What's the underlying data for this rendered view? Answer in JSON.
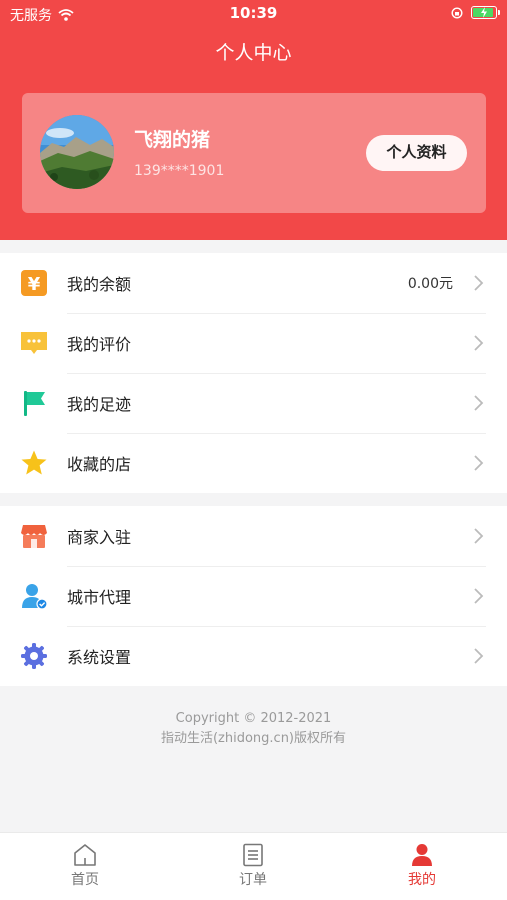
{
  "status_bar": {
    "carrier": "无服务",
    "time": "10:39"
  },
  "header": {
    "title": "个人中心"
  },
  "profile": {
    "name": "飞翔的猪",
    "phone": "139****1901",
    "button_label": "个人资料"
  },
  "menu_group_1": [
    {
      "label": "我的余额",
      "value": "0.00元",
      "icon": "wallet-icon"
    },
    {
      "label": "我的评价",
      "icon": "comment-icon"
    },
    {
      "label": "我的足迹",
      "icon": "flag-icon"
    },
    {
      "label": "收藏的店",
      "icon": "star-icon"
    }
  ],
  "menu_group_2": [
    {
      "label": "商家入驻",
      "icon": "shop-icon"
    },
    {
      "label": "城市代理",
      "icon": "agent-icon"
    },
    {
      "label": "系统设置",
      "icon": "gear-icon"
    }
  ],
  "footer": {
    "copyright": "Copyright © 2012-2021",
    "rights": "指动生活(zhidong.cn)版权所有"
  },
  "tabbar": [
    {
      "label": "首页",
      "icon": "home-icon",
      "active": false
    },
    {
      "label": "订单",
      "icon": "order-icon",
      "active": false
    },
    {
      "label": "我的",
      "icon": "user-icon",
      "active": true
    }
  ],
  "colors": {
    "header_red": "#f24848",
    "active_red": "#e53935"
  }
}
